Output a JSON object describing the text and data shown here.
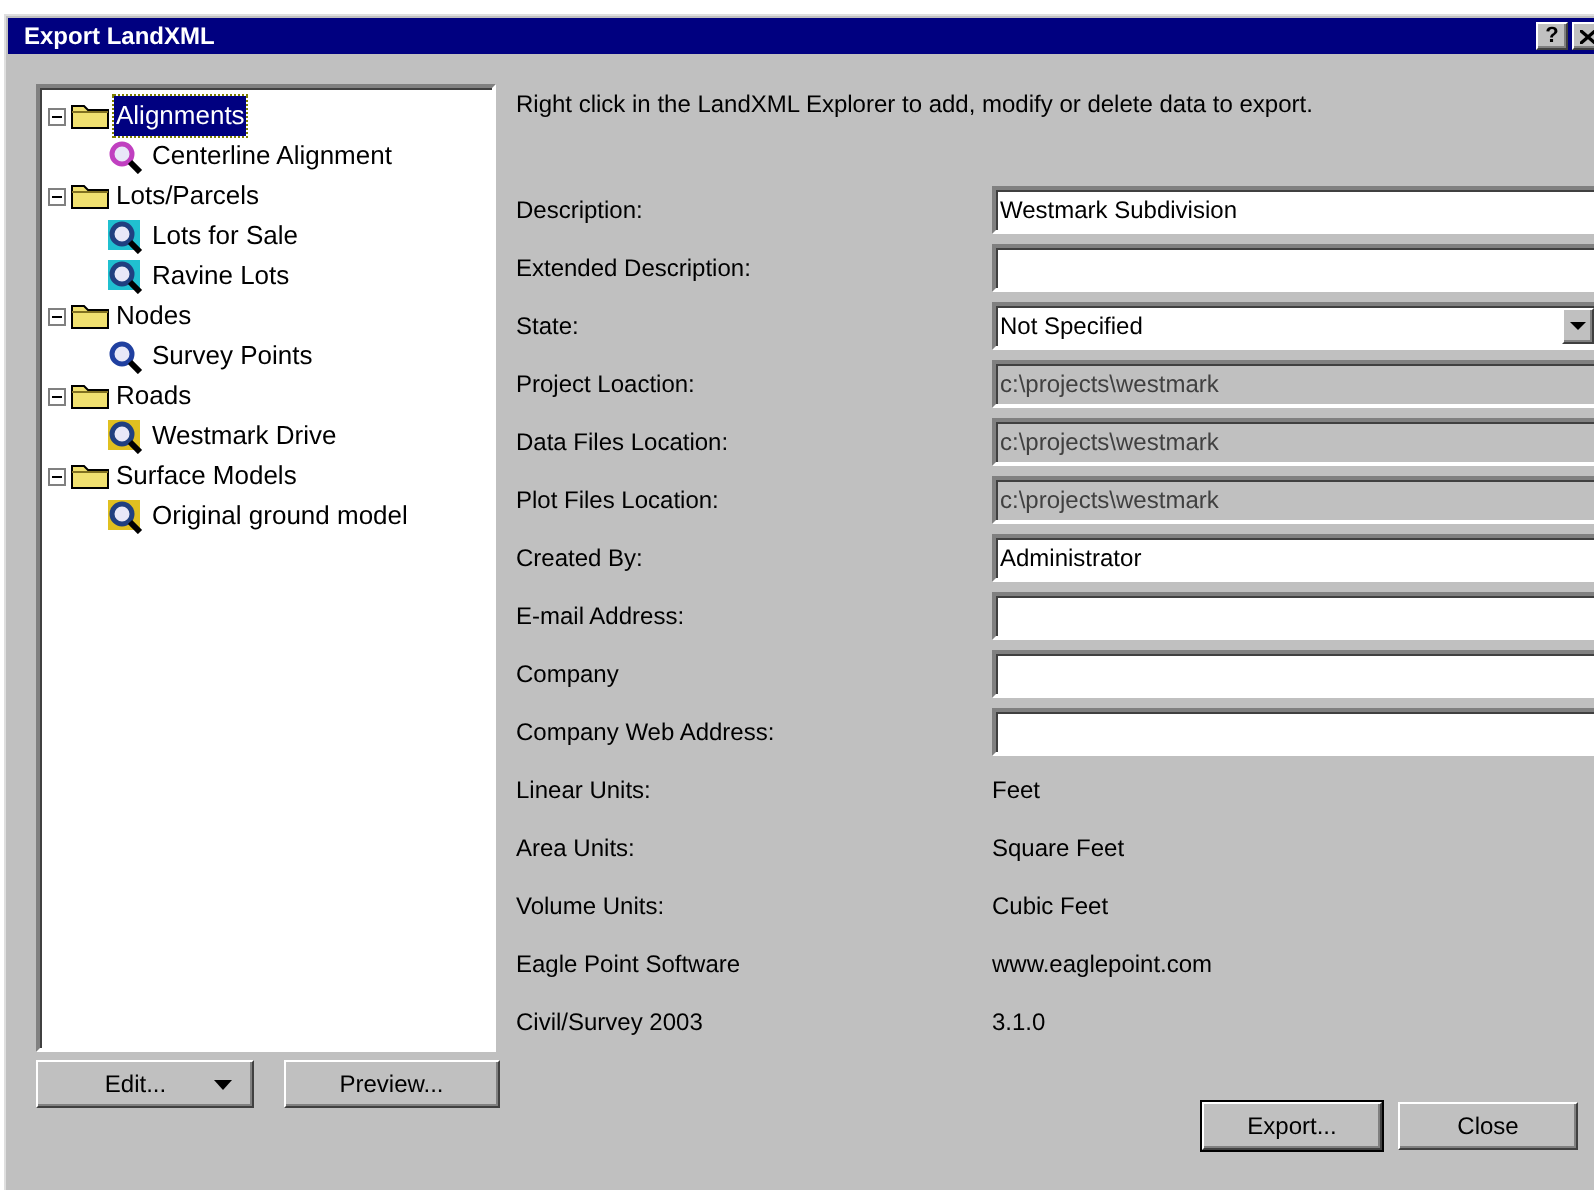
{
  "window": {
    "title": "Export LandXML",
    "help_button": "?"
  },
  "tree": [
    {
      "label": "Alignments",
      "selected": true,
      "expanded": true,
      "children": [
        {
          "label": "Centerline Alignment",
          "kind": "alignment",
          "selected": false
        }
      ]
    },
    {
      "label": "Lots/Parcels",
      "selected": false,
      "expanded": true,
      "children": [
        {
          "label": "Lots for Sale",
          "kind": "parcel",
          "selected": false
        },
        {
          "label": "Ravine Lots",
          "kind": "parcel",
          "selected": false
        }
      ]
    },
    {
      "label": "Nodes",
      "selected": false,
      "expanded": true,
      "children": [
        {
          "label": "Survey Points",
          "kind": "points",
          "selected": false
        }
      ]
    },
    {
      "label": "Roads",
      "selected": false,
      "expanded": true,
      "children": [
        {
          "label": "Westmark Drive",
          "kind": "road",
          "selected": false
        }
      ]
    },
    {
      "label": "Surface Models",
      "selected": false,
      "expanded": true,
      "children": [
        {
          "label": "Original ground model",
          "kind": "surface",
          "selected": false
        }
      ]
    }
  ],
  "tree_buttons": [
    {
      "label": "Edit...",
      "kind": "dropdown"
    },
    {
      "label": "Preview...",
      "kind": "plain"
    }
  ],
  "instructions": "Right click in the LandXML Explorer to add, modify or delete data to export.",
  "fields": [
    {
      "label": "Description:",
      "kind": "text",
      "value": "Westmark Subdivision"
    },
    {
      "label": "Extended Description:",
      "kind": "text"
    },
    {
      "label": "State:",
      "kind": "combo",
      "value": "Not Specified"
    },
    {
      "label": "Project Loaction:",
      "kind": "readonly",
      "value": "c:\\projects\\westmark"
    },
    {
      "label": "Data Files Location:",
      "kind": "readonly",
      "value": "c:\\projects\\westmark"
    },
    {
      "label": "Plot Files Location:",
      "kind": "readonly",
      "value": "c:\\projects\\westmark"
    },
    {
      "label": "Created By:",
      "kind": "text",
      "value": "Administrator"
    },
    {
      "label": "E-mail Address:",
      "kind": "text"
    },
    {
      "label": "Company",
      "kind": "text"
    },
    {
      "label": "Company Web Address:",
      "kind": "text"
    },
    {
      "label": "Linear Units:",
      "kind": "static",
      "value": "Feet"
    },
    {
      "label": "Area Units:",
      "kind": "static",
      "value": "Square Feet"
    },
    {
      "label": "Volume Units:",
      "kind": "static",
      "value": "Cubic Feet"
    },
    {
      "label": "Eagle Point Software",
      "kind": "static",
      "value": "www.eaglepoint.com"
    },
    {
      "label": "Civil/Survey 2003",
      "kind": "static",
      "value": "3.1.0"
    }
  ],
  "buttons": [
    {
      "label": "Export...",
      "default": true
    },
    {
      "label": "Close",
      "default": false
    }
  ]
}
